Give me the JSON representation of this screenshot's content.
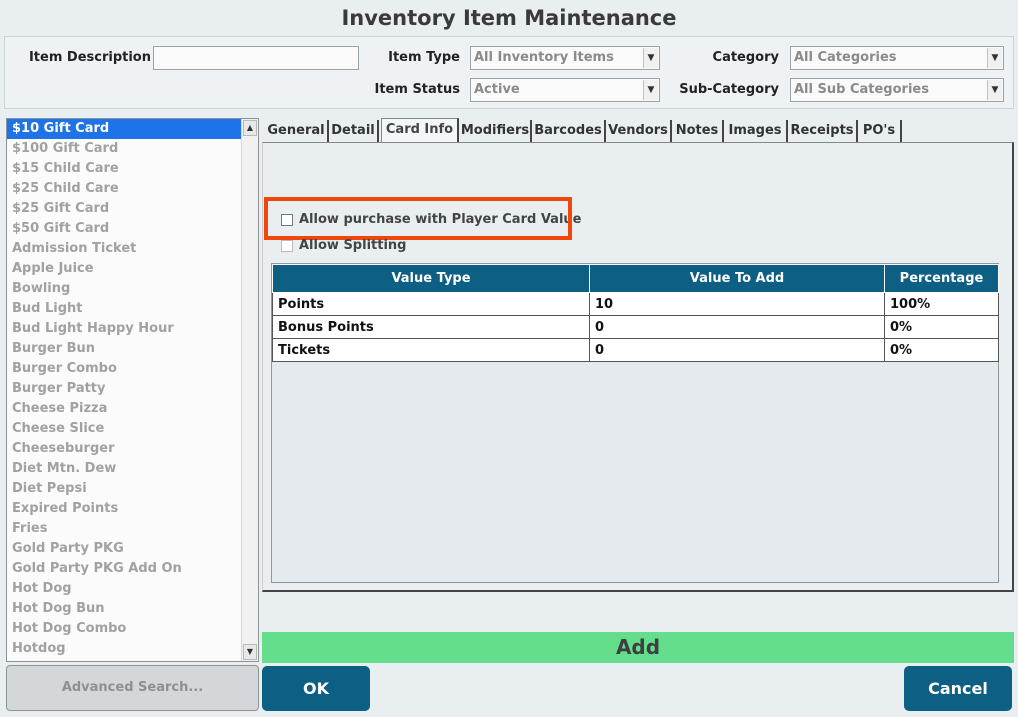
{
  "window": {
    "title": "Inventory Item Maintenance"
  },
  "filters": {
    "item_description_label": "Item Description",
    "item_description_value": "",
    "item_type_label": "Item Type",
    "item_type_value": "All Inventory Items",
    "category_label": "Category",
    "category_value": "All Categories",
    "item_status_label": "Item Status",
    "item_status_value": "Active",
    "sub_category_label": "Sub-Category",
    "sub_category_value": "All Sub Categories"
  },
  "item_list": {
    "selected_index": 0,
    "items": [
      "$10 Gift Card",
      "$100 Gift Card",
      "$15 Child Care",
      "$25 Child Care",
      "$25 Gift Card",
      "$50 Gift Card",
      "Admission Ticket",
      "Apple Juice",
      "Bowling",
      "Bud Light",
      "Bud Light Happy Hour",
      "Burger Bun",
      "Burger Combo",
      "Burger Patty",
      "Cheese Pizza",
      "Cheese Slice",
      "Cheeseburger",
      "Diet Mtn. Dew",
      "Diet Pepsi",
      "Expired Points",
      "Fries",
      "Gold Party PKG",
      "Gold Party PKG Add On",
      "Hot Dog",
      "Hot Dog Bun",
      "Hot Dog Combo",
      "Hotdog"
    ]
  },
  "advanced_search_label": "Advanced Search...",
  "tabs": {
    "active": "Card Info",
    "labels": [
      "General",
      "Detail",
      "Card Info",
      "Modifiers",
      "Barcodes",
      "Vendors",
      "Notes",
      "Images",
      "Receipts",
      "PO's"
    ]
  },
  "card_info": {
    "allow_player_card_label": "Allow purchase with Player Card Value",
    "allow_player_card_checked": false,
    "allow_splitting_label": "Allow Splitting",
    "allow_splitting_checked": false,
    "grid": {
      "columns": [
        "Value Type",
        "Value To Add",
        "Percentage"
      ],
      "rows": [
        {
          "type": "Points",
          "value": "10",
          "pct": "100%"
        },
        {
          "type": "Bonus Points",
          "value": "0",
          "pct": "0%"
        },
        {
          "type": "Tickets",
          "value": "0",
          "pct": "0%"
        }
      ]
    }
  },
  "actions": {
    "add_label": "Add",
    "ok_label": "OK",
    "cancel_label": "Cancel"
  },
  "colors": {
    "accent": "#0d5f84",
    "selection": "#1e73e8",
    "add_bar": "#64dd8c",
    "highlight": "#f0480c"
  }
}
